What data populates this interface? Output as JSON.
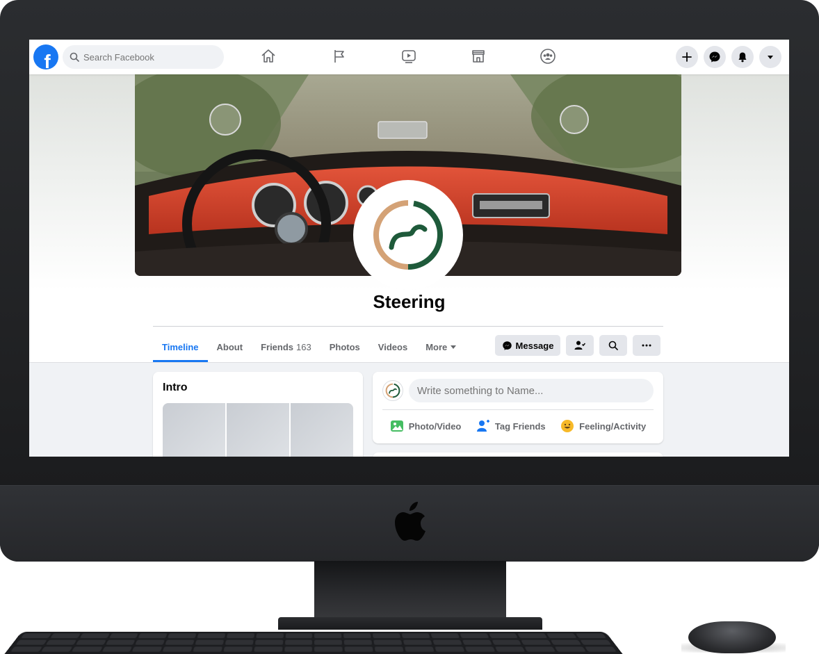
{
  "topnav": {
    "logo_letter": "f",
    "search_placeholder": "Search Facebook",
    "nav_icons": [
      "home-icon",
      "pages-flag-icon",
      "watch-video-icon",
      "marketplace-icon",
      "groups-icon"
    ],
    "right_buttons": [
      "plus-icon",
      "messenger-icon",
      "bell-icon",
      "caret-down-icon"
    ],
    "accent_color": "#1877f2"
  },
  "profile": {
    "name": "Steering",
    "logo_colors": {
      "arc_left": "#d4a276",
      "arc_right": "#1e5a3a"
    }
  },
  "tabs": [
    {
      "label": "Timeline",
      "active": true
    },
    {
      "label": "About"
    },
    {
      "label": "Friends",
      "count": "163"
    },
    {
      "label": "Photos"
    },
    {
      "label": "Videos"
    },
    {
      "label": "More"
    }
  ],
  "actions": {
    "message_label": "Message",
    "buttons": [
      "add-friend-icon",
      "search-icon",
      "more-icon"
    ]
  },
  "intro": {
    "title": "Intro"
  },
  "composer": {
    "placeholder": "Write something to Name...",
    "actions": [
      {
        "label": "Photo/Video",
        "icon": "photo-video-icon",
        "color": "#45bd62"
      },
      {
        "label": "Tag Friends",
        "icon": "tag-friends-icon",
        "color": "#1877f2"
      },
      {
        "label": "Feeling/Activity",
        "icon": "feeling-icon",
        "color": "#f7b928"
      }
    ]
  }
}
